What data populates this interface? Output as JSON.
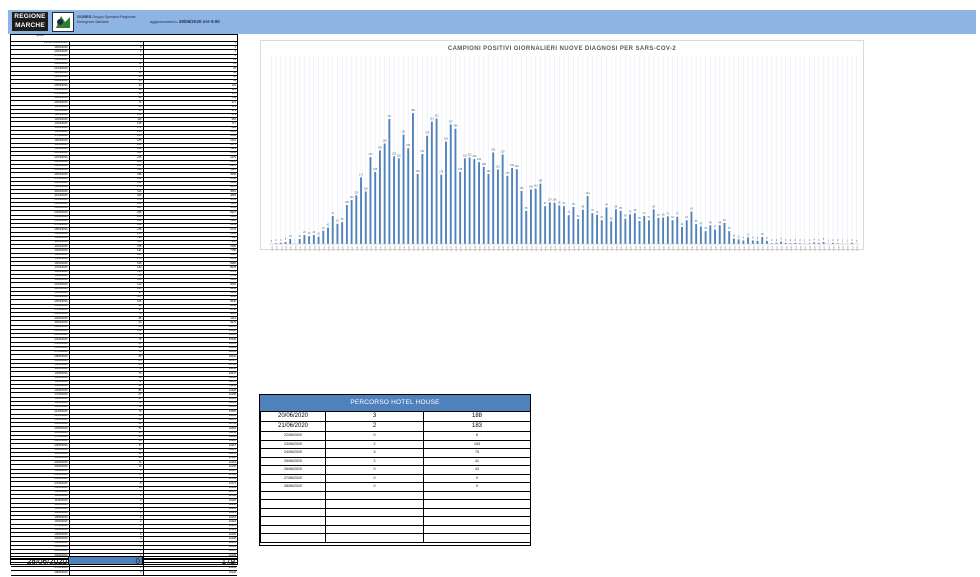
{
  "header": {
    "logo_line1": "REGIONE",
    "logo_line2": "MARCHE",
    "gores_name": "GORES",
    "gores_line1": "Gruppo Operativo Regionale",
    "gores_line2": "Emergenze Sanitarie",
    "update_label": "aggiornamento:",
    "update_value": "28/06/2020 ore 9.00"
  },
  "left_table": {
    "headers": [
      "giorno",
      "",
      ""
    ],
    "rows": [
      [
        "1-2-3-4 (25/02/2020)",
        "1",
        "1"
      ],
      [
        "25/02/2020",
        "0",
        "1"
      ],
      [
        "26/02/2020",
        "2",
        "3"
      ],
      [
        "27/02/2020",
        "3",
        "6"
      ],
      [
        "28/02/2020",
        "5",
        "11"
      ],
      [
        "29/02/2020",
        "13",
        "24"
      ],
      [
        "01/03/2020",
        "1",
        "25"
      ],
      [
        "02/03/2020",
        "13",
        "38"
      ],
      [
        "03/03/2020",
        "23",
        "61"
      ],
      [
        "04/03/2020",
        "20",
        "81"
      ],
      [
        "05/03/2020",
        "23",
        "104"
      ],
      [
        "06/03/2020",
        "19",
        "123"
      ],
      [
        "07/03/2020",
        "34",
        "157"
      ],
      [
        "08/03/2020",
        "42",
        "199"
      ],
      [
        "09/03/2020",
        "72",
        "271"
      ],
      [
        "10/03/2020",
        "52",
        "323"
      ],
      [
        "11/03/2020",
        "56",
        "379"
      ],
      [
        "12/03/2020",
        "100",
        "479"
      ],
      [
        "13/03/2020",
        "113",
        "592"
      ],
      [
        "14/03/2020",
        "125",
        "717"
      ],
      [
        "15/03/2020",
        "171",
        "888"
      ],
      [
        "16/03/2020",
        "135",
        "1023"
      ],
      [
        "17/03/2020",
        "223",
        "1246"
      ],
      [
        "18/03/2020",
        "185",
        "1431"
      ],
      [
        "19/03/2020",
        "240",
        "1671"
      ],
      [
        "20/03/2020",
        "258",
        "1929"
      ],
      [
        "21/03/2020",
        "321",
        "2250"
      ],
      [
        "22/03/2020",
        "225",
        "2475"
      ],
      [
        "23/03/2020",
        "220",
        "2695"
      ],
      [
        "24/03/2020",
        "281",
        "2976"
      ],
      [
        "25/03/2020",
        "246",
        "3222"
      ],
      [
        "26/03/2020",
        "336",
        "3558"
      ],
      [
        "27/03/2020",
        "180",
        "3738"
      ],
      [
        "28/03/2020",
        "231",
        "3969"
      ],
      [
        "29/03/2020",
        "278",
        "4247"
      ],
      [
        "30/03/2020",
        "314",
        "4561"
      ],
      [
        "31/03/2020",
        "322",
        "4883"
      ],
      [
        "01/04/2020",
        "178",
        "5061"
      ],
      [
        "02/04/2020",
        "263",
        "5324"
      ],
      [
        "03/04/2020",
        "307",
        "5631"
      ],
      [
        "04/04/2020",
        "296",
        "5927"
      ],
      [
        "05/04/2020",
        "185",
        "6112"
      ],
      [
        "06/04/2020",
        "220",
        "6332"
      ],
      [
        "07/04/2020",
        "222",
        "6554"
      ],
      [
        "08/04/2020",
        "218",
        "6772"
      ],
      [
        "09/04/2020",
        "210",
        "6982"
      ],
      [
        "10/04/2020",
        "198",
        "7180"
      ],
      [
        "11/04/2020",
        "180",
        "7360"
      ],
      [
        "12/04/2020",
        "235",
        "7595"
      ],
      [
        "13/04/2020",
        "191",
        "7786"
      ],
      [
        "14/04/2020",
        "230",
        "8016"
      ],
      [
        "15/04/2020",
        "175",
        "8191"
      ],
      [
        "16/04/2020",
        "195",
        "8386"
      ],
      [
        "17/04/2020",
        "192",
        "8578"
      ],
      [
        "18/04/2020",
        "136",
        "8714"
      ],
      [
        "19/04/2020",
        "85",
        "8799"
      ],
      [
        "20/04/2020",
        "140",
        "8939"
      ],
      [
        "21/04/2020",
        "142",
        "9081"
      ],
      [
        "22/04/2020",
        "155",
        "9236"
      ],
      [
        "23/04/2020",
        "97",
        "9333"
      ],
      [
        "24/04/2020",
        "107",
        "9440"
      ],
      [
        "25/04/2020",
        "106",
        "9546"
      ],
      [
        "26/04/2020",
        "99",
        "9645"
      ],
      [
        "27/04/2020",
        "97",
        "9742"
      ],
      [
        "28/04/2020",
        "74",
        "9816"
      ],
      [
        "29/04/2020",
        "95",
        "9911"
      ],
      [
        "30/04/2020",
        "64",
        "9975"
      ],
      [
        "01/05/2020",
        "88",
        "10063"
      ],
      [
        "02/05/2020",
        "123",
        "10186"
      ],
      [
        "03/05/2020",
        "79",
        "10265"
      ],
      [
        "04/05/2020",
        "75",
        "10340"
      ],
      [
        "05/05/2020",
        "61",
        "10401"
      ],
      [
        "06/05/2020",
        "94",
        "10495"
      ],
      [
        "07/05/2020",
        "58",
        "10553"
      ],
      [
        "08/05/2020",
        "89",
        "10642"
      ],
      [
        "09/05/2020",
        "85",
        "10727"
      ],
      [
        "10/05/2020",
        "65",
        "10792"
      ],
      [
        "11/05/2020",
        "76",
        "10868"
      ],
      [
        "12/05/2020",
        "79",
        "10947"
      ],
      [
        "13/05/2020",
        "59",
        "11006"
      ],
      [
        "14/05/2020",
        "72",
        "11078"
      ],
      [
        "15/05/2020",
        "61",
        "11139"
      ],
      [
        "16/05/2020",
        "89",
        "11228"
      ],
      [
        "17/05/2020",
        "67",
        "11295"
      ],
      [
        "18/05/2020",
        "68",
        "11363"
      ],
      [
        "19/05/2020",
        "71",
        "11434"
      ],
      [
        "20/05/2020",
        "61",
        "11495"
      ],
      [
        "21/05/2020",
        "70",
        "11565"
      ],
      [
        "22/05/2020",
        "44",
        "11609"
      ],
      [
        "23/05/2020",
        "61",
        "11670"
      ],
      [
        "24/05/2020",
        "83",
        "11753"
      ],
      [
        "25/05/2020",
        "51",
        "11804"
      ],
      [
        "26/05/2020",
        "45",
        "11849"
      ],
      [
        "27/05/2020",
        "33",
        "11882"
      ],
      [
        "28/05/2020",
        "48",
        "11930"
      ],
      [
        "29/05/2020",
        "37",
        "11967"
      ],
      [
        "30/05/2020",
        "48",
        "12015"
      ],
      [
        "31/05/2020",
        "54",
        "12069"
      ],
      [
        "01/06/2020",
        "33",
        "12102"
      ],
      [
        "02/06/2020",
        "14",
        "12116"
      ],
      [
        "03/06/2020",
        "12",
        "12128"
      ],
      [
        "04/06/2020",
        "9",
        "12137"
      ],
      [
        "05/06/2020",
        "17",
        "12154"
      ],
      [
        "06/06/2020",
        "9",
        "12163"
      ],
      [
        "07/06/2020",
        "8",
        "12171"
      ],
      [
        "08/06/2020",
        "18",
        "12189"
      ],
      [
        "09/06/2020",
        "8",
        "12197"
      ],
      [
        "10/06/2020",
        "2",
        "12199"
      ],
      [
        "11/06/2020",
        "3",
        "12202"
      ],
      [
        "12/06/2020",
        "6",
        "12208"
      ],
      [
        "13/06/2020",
        "3",
        "12211"
      ],
      [
        "14/06/2020",
        "2",
        "12213"
      ],
      [
        "15/06/2020",
        "3",
        "12216"
      ],
      [
        "16/06/2020",
        "2",
        "12218"
      ],
      [
        "17/06/2020",
        "1",
        "12219"
      ],
      [
        "18/06/2020",
        "2",
        "12221"
      ],
      [
        "19/06/2020",
        "4",
        "12225"
      ],
      [
        "20/06/2020",
        "3",
        "12228"
      ],
      [
        "21/06/2020",
        "5",
        "12233"
      ],
      [
        "22/06/2020",
        "1",
        "12234"
      ],
      [
        "23/06/2020",
        "3",
        "12237"
      ],
      [
        "24/06/2020",
        "2",
        "12239"
      ],
      [
        "25/06/2020",
        "1",
        "12240"
      ],
      [
        "26/06/2020",
        "1",
        "12241"
      ],
      [
        "27/06/2020",
        "3",
        "12244"
      ],
      [
        "28/06/2020",
        "0",
        "12244"
      ]
    ],
    "footer": [
      "28/06/2020",
      "0",
      "179"
    ]
  },
  "chart_data": {
    "type": "bar",
    "title": "CAMPIONI POSITIVI GIORNALIERI NUOVE DIAGNOSI PER SARS-COV-2",
    "xlabel": "",
    "ylabel": "",
    "ylim": [
      0,
      380
    ],
    "grid": true,
    "bar_color": "#4f81bd",
    "grid_color": "#d9e2f1",
    "categories": [
      "25/02",
      "26/02",
      "27/02",
      "28/02",
      "29/02",
      "01/03",
      "02/03",
      "03/03",
      "04/03",
      "05/03",
      "06/03",
      "07/03",
      "08/03",
      "09/03",
      "10/03",
      "11/03",
      "12/03",
      "13/03",
      "14/03",
      "15/03",
      "16/03",
      "17/03",
      "18/03",
      "19/03",
      "20/03",
      "21/03",
      "22/03",
      "23/03",
      "24/03",
      "25/03",
      "26/03",
      "27/03",
      "28/03",
      "29/03",
      "30/03",
      "31/03",
      "01/04",
      "02/04",
      "03/04",
      "04/04",
      "05/04",
      "06/04",
      "07/04",
      "08/04",
      "09/04",
      "10/04",
      "11/04",
      "12/04",
      "13/04",
      "14/04",
      "15/04",
      "16/04",
      "17/04",
      "18/04",
      "19/04",
      "20/04",
      "21/04",
      "22/04",
      "23/04",
      "24/04",
      "25/04",
      "26/04",
      "27/04",
      "28/04",
      "29/04",
      "30/04",
      "01/05",
      "02/05",
      "03/05",
      "04/05",
      "05/05",
      "06/05",
      "07/05",
      "08/05",
      "09/05",
      "10/05",
      "11/05",
      "12/05",
      "13/05",
      "14/05",
      "15/05",
      "16/05",
      "17/05",
      "18/05",
      "19/05",
      "20/05",
      "21/05",
      "22/05",
      "23/05",
      "24/05",
      "25/05",
      "26/05",
      "27/05",
      "28/05",
      "29/05",
      "30/05",
      "31/05",
      "01/06",
      "02/06",
      "03/06",
      "04/06",
      "05/06",
      "06/06",
      "07/06",
      "08/06",
      "09/06",
      "10/06",
      "11/06",
      "12/06",
      "13/06",
      "14/06",
      "15/06",
      "16/06",
      "17/06",
      "18/06",
      "19/06",
      "20/06",
      "21/06",
      "22/06",
      "23/06",
      "24/06",
      "25/06",
      "26/06",
      "27/06",
      "28/06"
    ],
    "values": [
      0,
      2,
      3,
      5,
      13,
      1,
      13,
      23,
      20,
      23,
      19,
      34,
      42,
      72,
      52,
      56,
      100,
      113,
      125,
      171,
      135,
      223,
      185,
      240,
      258,
      321,
      225,
      220,
      281,
      246,
      336,
      180,
      231,
      278,
      314,
      322,
      178,
      263,
      307,
      296,
      185,
      220,
      222,
      218,
      210,
      198,
      180,
      235,
      191,
      230,
      175,
      195,
      192,
      136,
      85,
      140,
      142,
      155,
      97,
      107,
      106,
      99,
      97,
      74,
      95,
      64,
      88,
      123,
      79,
      75,
      61,
      94,
      58,
      89,
      85,
      65,
      76,
      79,
      59,
      72,
      61,
      89,
      67,
      68,
      71,
      61,
      70,
      44,
      61,
      83,
      51,
      45,
      33,
      48,
      37,
      48,
      54,
      33,
      14,
      12,
      9,
      17,
      9,
      8,
      18,
      8,
      2,
      3,
      6,
      3,
      2,
      3,
      2,
      1,
      2,
      4,
      3,
      5,
      1,
      3,
      2,
      1,
      1,
      3,
      0
    ]
  },
  "hotel_house": {
    "title": "PERCORSO HOTEL HOUSE",
    "rows_big": [
      [
        "20/06/2020",
        "3",
        "188"
      ],
      [
        "21/06/2020",
        "2",
        "183"
      ]
    ],
    "rows_small": [
      [
        "22/06/2020",
        "0",
        "6"
      ],
      [
        "23/06/2020",
        "2",
        "153"
      ],
      [
        "24/06/2020",
        "3",
        "75"
      ],
      [
        "25/06/2020",
        "2",
        "41"
      ],
      [
        "26/06/2020",
        "0",
        "43"
      ],
      [
        "27/06/2020",
        "0",
        "0"
      ],
      [
        "28/06/2020",
        "0",
        "0"
      ]
    ]
  }
}
